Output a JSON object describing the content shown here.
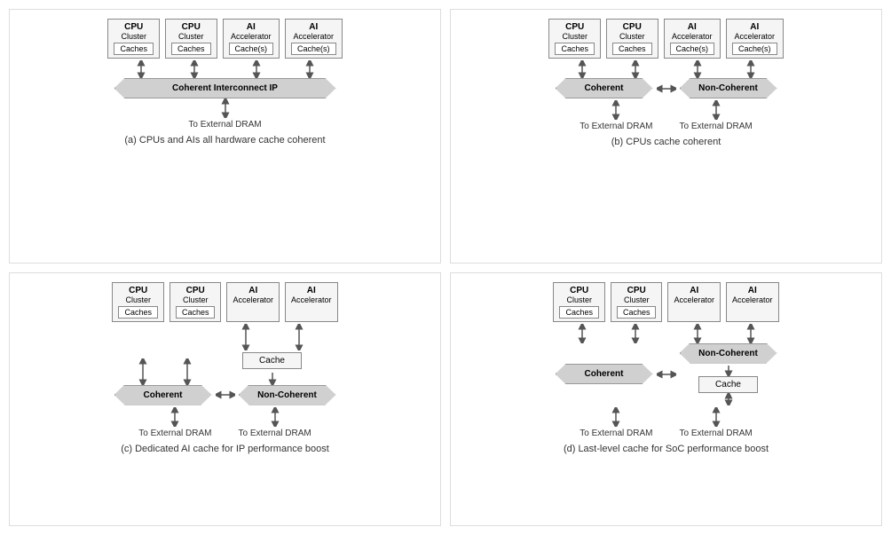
{
  "diagrams": [
    {
      "id": "a",
      "caption": "(a) CPUs and AIs all hardware cache coherent",
      "components": [
        {
          "title": "CPU",
          "subtitle": "Cluster",
          "cache": "Caches"
        },
        {
          "title": "CPU",
          "subtitle": "Cluster",
          "cache": "Caches"
        },
        {
          "title": "AI",
          "subtitle": "Accelerator",
          "cache": "Cache(s)"
        },
        {
          "title": "AI",
          "subtitle": "Accelerator",
          "cache": "Cache(s)"
        }
      ],
      "interconnect": "Coherent Interconnect IP",
      "type": "single",
      "dram": [
        "To External DRAM"
      ]
    },
    {
      "id": "b",
      "caption": "(b) CPUs cache coherent",
      "components": [
        {
          "title": "CPU",
          "subtitle": "Cluster",
          "cache": "Caches"
        },
        {
          "title": "CPU",
          "subtitle": "Cluster",
          "cache": "Caches"
        },
        {
          "title": "AI",
          "subtitle": "Accelerator",
          "cache": "Cache(s)"
        },
        {
          "title": "AI",
          "subtitle": "Accelerator",
          "cache": "Cache(s)"
        }
      ],
      "interconnect_left": "Coherent",
      "interconnect_right": "Non-Coherent",
      "type": "double",
      "dram": [
        "To External DRAM",
        "To External DRAM"
      ]
    },
    {
      "id": "c",
      "caption": "(c) Dedicated AI cache for IP performance boost",
      "components": [
        {
          "title": "CPU",
          "subtitle": "Cluster",
          "cache": "Caches"
        },
        {
          "title": "CPU",
          "subtitle": "Cluster",
          "cache": "Caches"
        },
        {
          "title": "AI",
          "subtitle": "Accelerator",
          "cache": null
        },
        {
          "title": "AI",
          "subtitle": "Accelerator",
          "cache": null
        }
      ],
      "extra_cache": "Cache",
      "interconnect_left": "Coherent",
      "interconnect_right": "Non-Coherent",
      "type": "double_with_extra_cache",
      "dram": [
        "To External DRAM",
        "To External DRAM"
      ]
    },
    {
      "id": "d",
      "caption": "(d) Last-level cache for SoC performance boost",
      "components": [
        {
          "title": "CPU",
          "subtitle": "Cluster",
          "cache": "Caches"
        },
        {
          "title": "CPU",
          "subtitle": "Cluster",
          "cache": "Caches"
        },
        {
          "title": "AI",
          "subtitle": "Accelerator",
          "cache": null
        },
        {
          "title": "AI",
          "subtitle": "Accelerator",
          "cache": null
        }
      ],
      "extra_cache": "Cache",
      "interconnect_left": "Coherent",
      "interconnect_right": "Non-Coherent",
      "type": "double_with_bottom_cache",
      "dram": [
        "To External DRAM",
        "To External DRAM"
      ]
    }
  ]
}
